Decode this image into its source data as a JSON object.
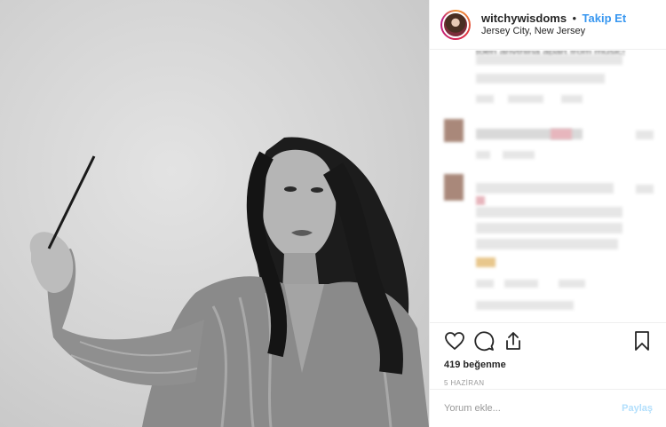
{
  "post": {
    "username": "witchywisdoms",
    "separator": "•",
    "follow_label": "Takip Et",
    "location": "Jersey City, New Jersey",
    "likes_text": "419 beğenme",
    "date_text": "5 HAZİRAN"
  },
  "comments": {
    "partial_text": "toen anvthina apart from music!"
  },
  "actions": {
    "icons": [
      "heart-icon",
      "comment-icon",
      "share-icon",
      "bookmark-icon"
    ]
  },
  "comment_box": {
    "placeholder": "Yorum ekle...",
    "post_label": "Paylaş"
  },
  "colors": {
    "link_blue": "#3897f0",
    "disabled_blue": "#b2dffc",
    "border": "#efefef"
  }
}
